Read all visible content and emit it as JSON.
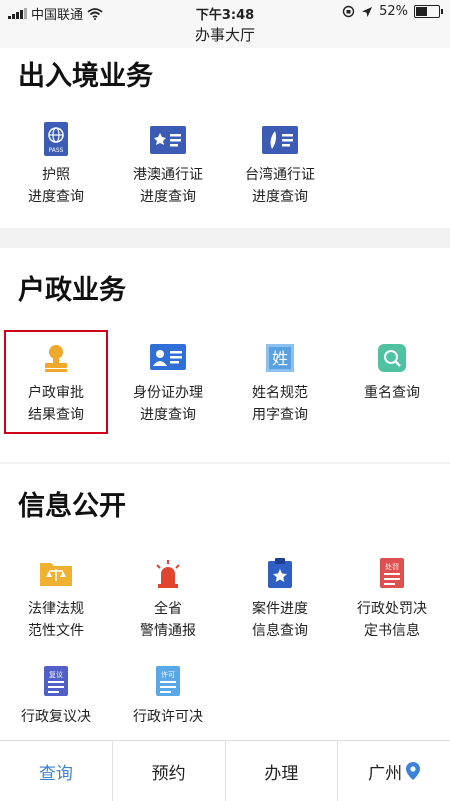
{
  "status_bar": {
    "carrier": "中国联通",
    "time": "下午3:48",
    "battery": "52%",
    "battery_level": 0.52
  },
  "header": {
    "title": "办事大厅"
  },
  "sections": [
    {
      "title": "出入境业务",
      "items": [
        {
          "label": "护照\n进度查询",
          "icon": "passport-icon",
          "color": "#3b5bb5"
        },
        {
          "label": "港澳通行证\n进度查询",
          "icon": "hk-macau-permit-icon",
          "color": "#3b5bb5"
        },
        {
          "label": "台湾通行证\n进度查询",
          "icon": "taiwan-permit-icon",
          "color": "#3b5bb5"
        }
      ]
    },
    {
      "title": "户政业务",
      "items": [
        {
          "label": "户政审批\n结果查询",
          "icon": "stamp-icon",
          "color": "#f0a92b"
        },
        {
          "label": "身份证办理\n进度查询",
          "icon": "id-card-icon",
          "color": "#2f6fd6"
        },
        {
          "label": "姓名规范\n用字查询",
          "icon": "name-char-icon",
          "color": "#5aa0e0"
        },
        {
          "label": "重名查询",
          "icon": "search-card-icon",
          "color": "#4fc3a1"
        }
      ]
    },
    {
      "title": "信息公开",
      "items": [
        {
          "label": "法律法规\n范性文件",
          "icon": "law-folder-icon",
          "color": "#f0b030"
        },
        {
          "label": "全省\n警情通报",
          "icon": "siren-icon",
          "color": "#e0452e"
        },
        {
          "label": "案件进度\n信息查询",
          "icon": "case-clipboard-icon",
          "color": "#2f5fc4"
        },
        {
          "label": "行政处罚决\n定书信息",
          "icon": "penalty-doc-icon",
          "color": "#e05050"
        },
        {
          "label": "行政复议决",
          "icon": "review-doc-icon",
          "color": "#5060c8"
        },
        {
          "label": "行政许可决",
          "icon": "permit-doc-icon",
          "color": "#5aa8e8"
        }
      ]
    }
  ],
  "doc_icon_text": {
    "penalty": "处罚",
    "review": "复议",
    "permit": "许可",
    "name_char": "姓",
    "passport": "PASS"
  },
  "tabbar": [
    {
      "label": "查询",
      "active": true
    },
    {
      "label": "预约",
      "active": false
    },
    {
      "label": "办理",
      "active": false
    },
    {
      "label": "广州",
      "active": false
    }
  ],
  "colors": {
    "accent": "#3b82d6",
    "highlight": "#d0021b",
    "location_pin": "#3b82d6"
  }
}
